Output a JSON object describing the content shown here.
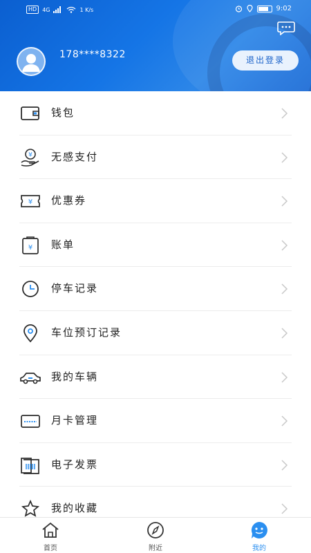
{
  "status_bar": {
    "left_text": [
      "HD",
      "4G",
      "1 K/s"
    ],
    "time": "9:02"
  },
  "header": {
    "phone": "178****8322",
    "logout_label": "退出登录",
    "accent": "#1575e6"
  },
  "menu": [
    {
      "label": "钱包",
      "icon": "wallet-icon"
    },
    {
      "label": "无感支付",
      "icon": "hand-coin-icon"
    },
    {
      "label": "优惠券",
      "icon": "coupon-icon"
    },
    {
      "label": "账单",
      "icon": "bill-icon"
    },
    {
      "label": "停车记录",
      "icon": "clock-icon"
    },
    {
      "label": "车位预订记录",
      "icon": "location-pin-icon"
    },
    {
      "label": "我的车辆",
      "icon": "car-icon"
    },
    {
      "label": "月卡管理",
      "icon": "card-icon"
    },
    {
      "label": "电子发票",
      "icon": "invoice-icon"
    },
    {
      "label": "我的收藏",
      "icon": "star-icon"
    }
  ],
  "tabs": [
    {
      "label": "首页",
      "icon": "home-icon",
      "active": false
    },
    {
      "label": "附近",
      "icon": "compass-icon",
      "active": false
    },
    {
      "label": "我的",
      "icon": "user-bubble-icon",
      "active": true
    }
  ]
}
